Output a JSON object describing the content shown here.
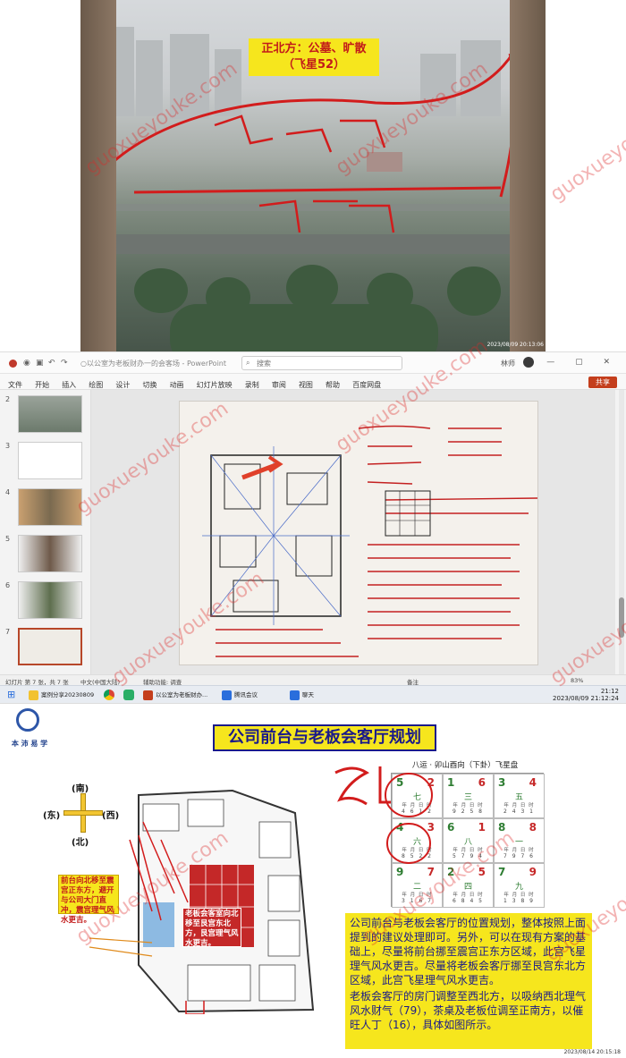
{
  "watermark": "guoxueyouke.com",
  "panel1": {
    "note_line1": "正北方：公墓、旷散",
    "note_line2": "（飞星52）",
    "timestamp": "2023/08/09 20:13:06"
  },
  "panel2": {
    "doc_title": "○以公室为老板财办一的会客场 - PowerPoint",
    "search_placeholder": "搜索",
    "user": "林师",
    "window_buttons": "— ▢ ✕",
    "menu": [
      "文件",
      "开始",
      "插入",
      "绘图",
      "设计",
      "切换",
      "动画",
      "幻灯片放映",
      "录制",
      "审阅",
      "视图",
      "帮助",
      "百度网盘"
    ],
    "share_label": "共享",
    "thumb_numbers": [
      "2",
      "3",
      "4",
      "5",
      "6",
      "7"
    ],
    "slide_counter": "幻灯片 第 7 张，共 7 张",
    "language": "中文(中国大陆)",
    "accessibility": "辅助功能: 调查",
    "notes_label": "备注",
    "zoom": "83%",
    "taskbar_items": [
      "案例分享20230809",
      "以公室为老板财办...",
      "腾讯会议",
      "聊天"
    ],
    "clock_time": "21:12",
    "clock_date": "2023/08/09 21:12:24"
  },
  "panel3": {
    "logo_text": "本 沛 易 学",
    "title": "公司前台与老板会客厅规划",
    "compass": {
      "south": "(南)",
      "north": "(北)",
      "east": "(东)",
      "west": "(西)"
    },
    "box_a": "前台向北移至震宫正东方，避开与公司大门直冲，震宫理气风水更吉。",
    "box_b": "老板会客室向北移至艮宫东北方，艮宫理气风水更吉。",
    "grid_title": "八运 · 卯山酉向（下卦）飞星盘",
    "grid": [
      {
        "left": "5",
        "right": "2",
        "center": "七",
        "label": "年 月 日 时",
        "digits": "4 6 1 2"
      },
      {
        "left": "1",
        "right": "6",
        "center": "三",
        "label": "年 月 日 时",
        "digits": "9 2 5 8"
      },
      {
        "left": "3",
        "right": "4",
        "center": "五",
        "label": "年 月 日 时",
        "digits": "2 4 3 1"
      },
      {
        "left": "4",
        "right": "3",
        "center": "六",
        "label": "年 月 日 时",
        "digits": "8 5 2 2"
      },
      {
        "left": "6",
        "right": "1",
        "center": "八",
        "label": "年 月 日 时",
        "digits": "5 7 9 4"
      },
      {
        "left": "8",
        "right": "8",
        "center": "一",
        "label": "年 月 日 时",
        "digits": "7 9 7 6"
      },
      {
        "left": "9",
        "right": "7",
        "center": "二",
        "label": "年 月 日 时",
        "digits": "3 1 6 7"
      },
      {
        "left": "2",
        "right": "5",
        "center": "四",
        "label": "年 月 日 时",
        "digits": "6 8 4 5"
      },
      {
        "left": "7",
        "right": "9",
        "center": "九",
        "label": "年 月 日 时",
        "digits": "1 3 8 9"
      }
    ],
    "para1": "公司前台与老板会客厅的位置规划，整体按照上面提到的建议处理即可。另外，可以在现有方案的基础上，尽量将前台挪至震宫正东方区域，此宫飞星理气风水更吉。尽量将老板会客厅挪至艮宫东北方区域，此宫飞星理气风水更吉。",
    "para2": "老板会客厅的房门调整至西北方，以吸纳西北理气风水财气（79），茶桌及老板位调至正南方，以催旺人丁（16），具体如图所示。",
    "timestamp": "2023/08/14 20:15:18"
  }
}
